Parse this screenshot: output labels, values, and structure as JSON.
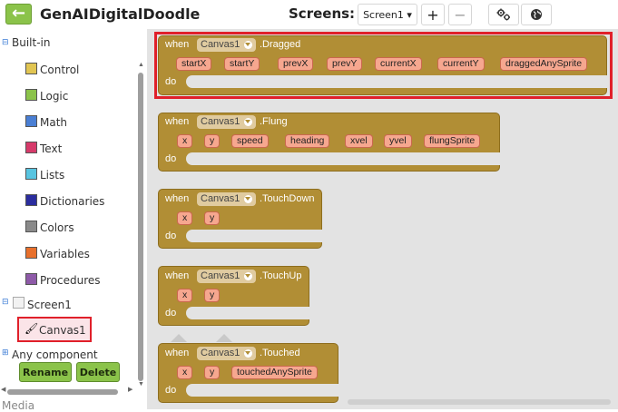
{
  "header": {
    "back_icon": "←",
    "app_title": "GenAIDigitalDoodle",
    "screens_label": "Screens:",
    "screen_select": "Screen1 ▾",
    "add_label": "+",
    "remove_label": "−"
  },
  "tree": {
    "builtin_label": "Built-in",
    "categories": [
      {
        "label": "Control",
        "color": "#e1c552"
      },
      {
        "label": "Logic",
        "color": "#8bc34a"
      },
      {
        "label": "Math",
        "color": "#4a7fd4"
      },
      {
        "label": "Text",
        "color": "#d63a6a"
      },
      {
        "label": "Lists",
        "color": "#58c4e0"
      },
      {
        "label": "Dictionaries",
        "color": "#2b2d9e"
      },
      {
        "label": "Colors",
        "color": "#8a8a8a"
      },
      {
        "label": "Variables",
        "color": "#e8702c"
      },
      {
        "label": "Procedures",
        "color": "#8e5aa8"
      }
    ],
    "screen_label": "Screen1",
    "canvas_label": "Canvas1",
    "any_component_label": "Any component",
    "rename_button": "Rename",
    "delete_button": "Delete",
    "media_label": "Media"
  },
  "blocks": [
    {
      "when": "when",
      "component": "Canvas1",
      "event": ".Dragged",
      "params": [
        "startX",
        "startY",
        "prevX",
        "prevY",
        "currentX",
        "currentY",
        "draggedAnySprite"
      ],
      "do": "do"
    },
    {
      "when": "when",
      "component": "Canvas1",
      "event": ".Flung",
      "params": [
        "x",
        "y",
        "speed",
        "heading",
        "xvel",
        "yvel",
        "flungSprite"
      ],
      "do": "do"
    },
    {
      "when": "when",
      "component": "Canvas1",
      "event": ".TouchDown",
      "params": [
        "x",
        "y"
      ],
      "do": "do"
    },
    {
      "when": "when",
      "component": "Canvas1",
      "event": ".TouchUp",
      "params": [
        "x",
        "y"
      ],
      "do": "do"
    },
    {
      "when": "when",
      "component": "Canvas1",
      "event": ".Touched",
      "params": [
        "x",
        "y",
        "touchedAnySprite"
      ],
      "do": "do"
    }
  ]
}
